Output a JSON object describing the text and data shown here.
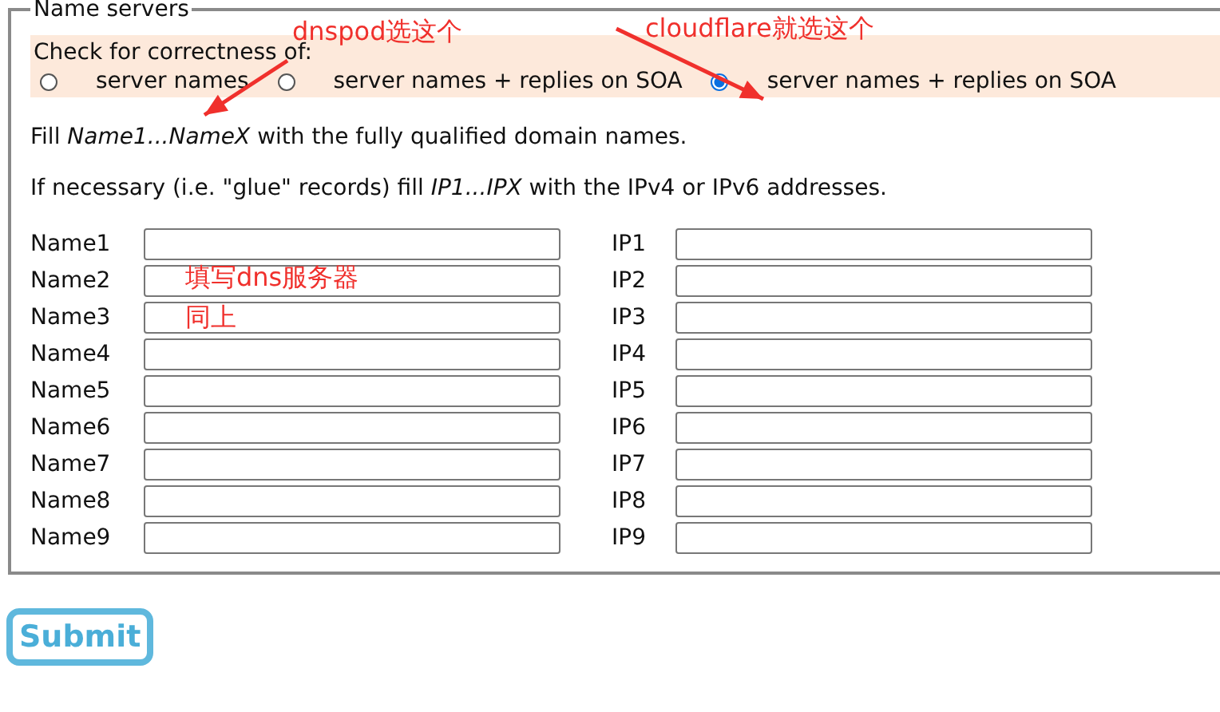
{
  "fieldset": {
    "legend": "Name servers",
    "check": {
      "label": "Check for correctness of:",
      "options": [
        {
          "label": "server names",
          "selected": false
        },
        {
          "label": "server names + replies on SOA",
          "selected": false
        },
        {
          "label": "server names + replies on SOA",
          "selected": true
        }
      ]
    },
    "instructions": [
      "Fill *Name1...NameX* with the fully qualified domain names.",
      "If necessary (i.e. \"glue\" records) fill *IP1...IPX* with the IPv4 or IPv6 addresses."
    ],
    "rows": [
      {
        "name_label": "Name1",
        "ip_label": "IP1"
      },
      {
        "name_label": "Name2",
        "ip_label": "IP2"
      },
      {
        "name_label": "Name3",
        "ip_label": "IP3"
      },
      {
        "name_label": "Name4",
        "ip_label": "IP4"
      },
      {
        "name_label": "Name5",
        "ip_label": "IP5"
      },
      {
        "name_label": "Name6",
        "ip_label": "IP6"
      },
      {
        "name_label": "Name7",
        "ip_label": "IP7"
      },
      {
        "name_label": "Name8",
        "ip_label": "IP8"
      },
      {
        "name_label": "Name9",
        "ip_label": "IP9"
      }
    ]
  },
  "annotations": [
    {
      "text": "dnspod选这个",
      "kind": "arrow"
    },
    {
      "text": "cloudflare就选这个",
      "kind": "arrow"
    },
    {
      "text": "填写dns服务器",
      "kind": "note"
    },
    {
      "text": "同上",
      "kind": "note"
    }
  ],
  "submit": "Submit"
}
